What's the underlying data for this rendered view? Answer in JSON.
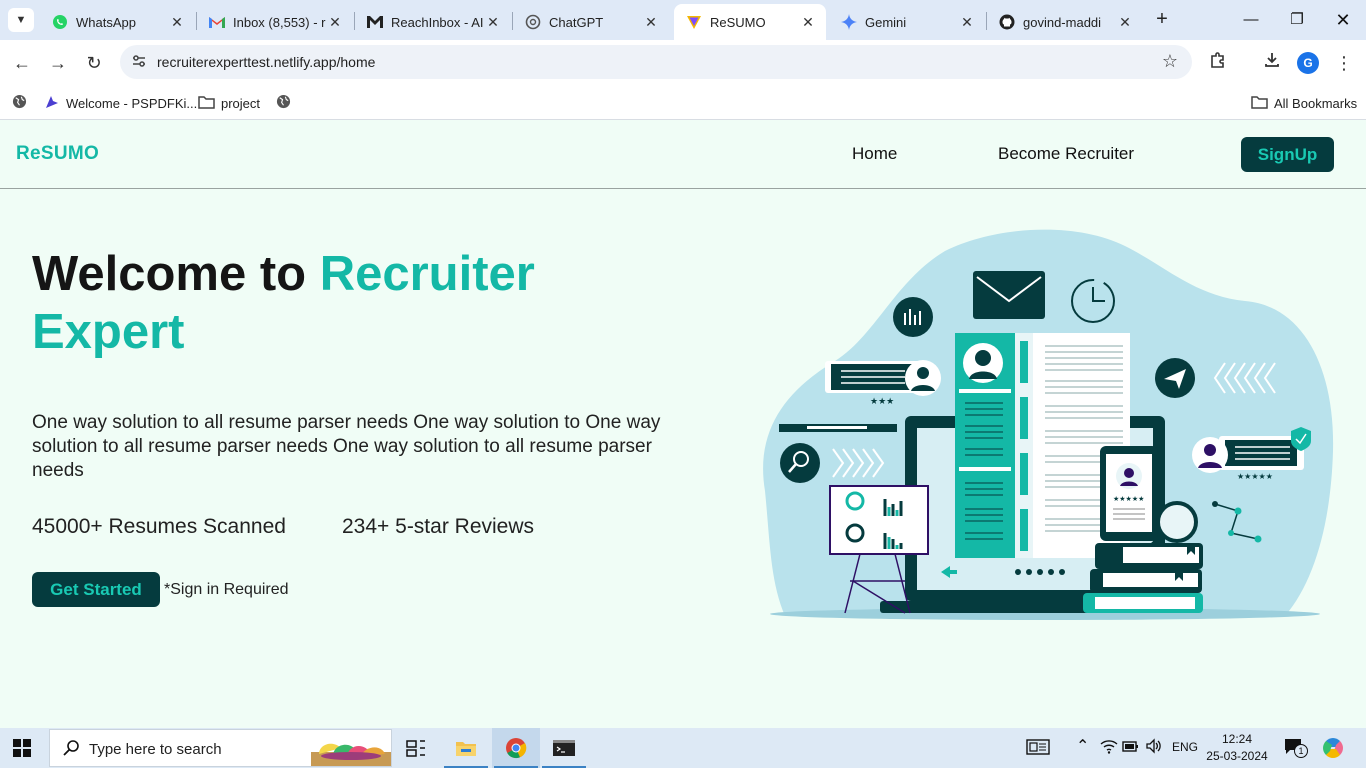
{
  "browser": {
    "tabs": [
      {
        "title": "WhatsApp",
        "icon": "whatsapp-icon",
        "active": false
      },
      {
        "title": "Inbox (8,553) - r",
        "icon": "gmail-icon",
        "active": false
      },
      {
        "title": "ReachInbox - AI",
        "icon": "reachinbox-icon",
        "active": false
      },
      {
        "title": "ChatGPT",
        "icon": "chatgpt-icon",
        "active": false
      },
      {
        "title": "ReSUMO",
        "icon": "resumo-icon",
        "active": true
      },
      {
        "title": "Gemini",
        "icon": "gemini-icon",
        "active": false
      },
      {
        "title": "govind-maddi",
        "icon": "github-icon",
        "active": false
      }
    ],
    "url": "recruiterexperttest.netlify.app/home",
    "profile_initial": "G",
    "bookmarks": [
      {
        "label": "",
        "icon": "globe-icon"
      },
      {
        "label": "Welcome - PSPDFKi...",
        "icon": "pspdfkit-icon"
      },
      {
        "label": "project",
        "icon": "folder-icon"
      },
      {
        "label": "",
        "icon": "globe-icon"
      }
    ],
    "all_bookmarks": "All Bookmarks"
  },
  "site": {
    "brand": "ReSUMO",
    "nav": {
      "home": "Home",
      "become_recruiter": "Become Recruiter",
      "signup": "SignUp"
    },
    "hero": {
      "title_part1": "Welcome to ",
      "title_part2": "Recruiter",
      "title_part3": "Expert",
      "description": "One way solution to all resume parser needs One way solution to One way solution to all resume parser needs One way solution to all resume parser needs",
      "stats": [
        "45000+ Resumes Scanned",
        "234+ 5-star Reviews"
      ],
      "cta": "Get Started",
      "cta_note": "*Sign in Required"
    },
    "colors": {
      "accent": "#14b8a6",
      "dark": "#053b3e",
      "background": "#f0fdf6"
    }
  },
  "taskbar": {
    "search_placeholder": "Type here to search",
    "language": "ENG",
    "time": "12:24",
    "date": "25-03-2024",
    "notification_count": "1"
  }
}
